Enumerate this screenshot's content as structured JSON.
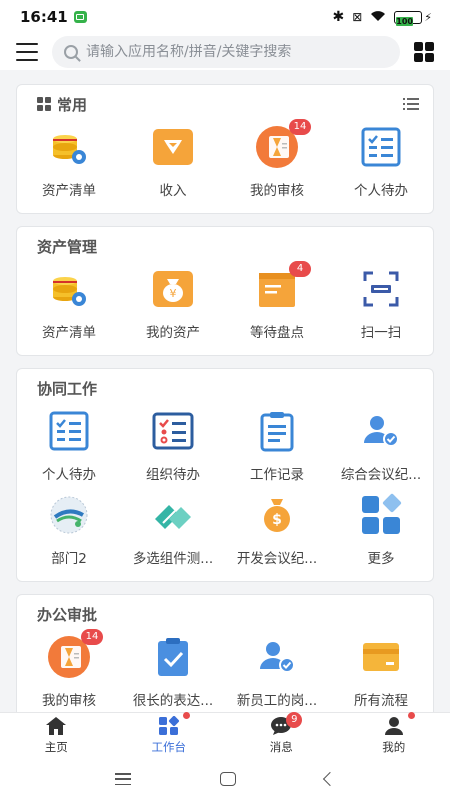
{
  "status": {
    "time": "16:41",
    "battery": "100"
  },
  "search": {
    "placeholder": "请输入应用名称/拼音/关键字搜索"
  },
  "sections": [
    {
      "title": "常用",
      "apps": [
        {
          "label": "资产清单",
          "icon": "coins-gear-icon"
        },
        {
          "label": "收入",
          "icon": "income-icon"
        },
        {
          "label": "我的审核",
          "icon": "hourglass-doc-icon",
          "badge": "14"
        },
        {
          "label": "个人待办",
          "icon": "checklist-icon"
        }
      ]
    },
    {
      "title": "资产管理",
      "apps": [
        {
          "label": "资产清单",
          "icon": "coins-gear-icon"
        },
        {
          "label": "我的资产",
          "icon": "money-bag-icon"
        },
        {
          "label": "等待盘点",
          "icon": "inventory-box-icon",
          "badge": "4"
        },
        {
          "label": "扫一扫",
          "icon": "scan-icon"
        }
      ]
    },
    {
      "title": "协同工作",
      "apps": [
        {
          "label": "个人待办",
          "icon": "checklist-icon"
        },
        {
          "label": "组织待办",
          "icon": "org-todo-icon"
        },
        {
          "label": "工作记录",
          "icon": "clipboard-icon"
        },
        {
          "label": "综合会议纪...",
          "icon": "user-check-icon"
        },
        {
          "label": "部门2",
          "icon": "globe-logo-icon"
        },
        {
          "label": "多选组件测...",
          "icon": "diamond-icon"
        },
        {
          "label": "开发会议纪...",
          "icon": "money-pouch-icon"
        },
        {
          "label": "更多",
          "icon": "more-apps-icon"
        }
      ]
    },
    {
      "title": "办公审批",
      "apps": [
        {
          "label": "我的审核",
          "icon": "hourglass-doc-icon",
          "badge": "14"
        },
        {
          "label": "很长的表达...",
          "icon": "clipboard-check-icon"
        },
        {
          "label": "新员工的岗...",
          "icon": "user-check-icon"
        },
        {
          "label": "所有流程",
          "icon": "card-icon"
        }
      ]
    }
  ],
  "tabs": [
    {
      "label": "主页",
      "icon": "home-icon"
    },
    {
      "label": "工作台",
      "icon": "workbench-icon",
      "dot": true
    },
    {
      "label": "消息",
      "icon": "chat-icon",
      "badge": "9"
    },
    {
      "label": "我的",
      "icon": "profile-icon",
      "dot": true
    }
  ],
  "colors": {
    "accent": "#3b6fd8",
    "badge": "#e84b4b",
    "orange": "#f5a43a",
    "blue": "#3a86d6"
  }
}
